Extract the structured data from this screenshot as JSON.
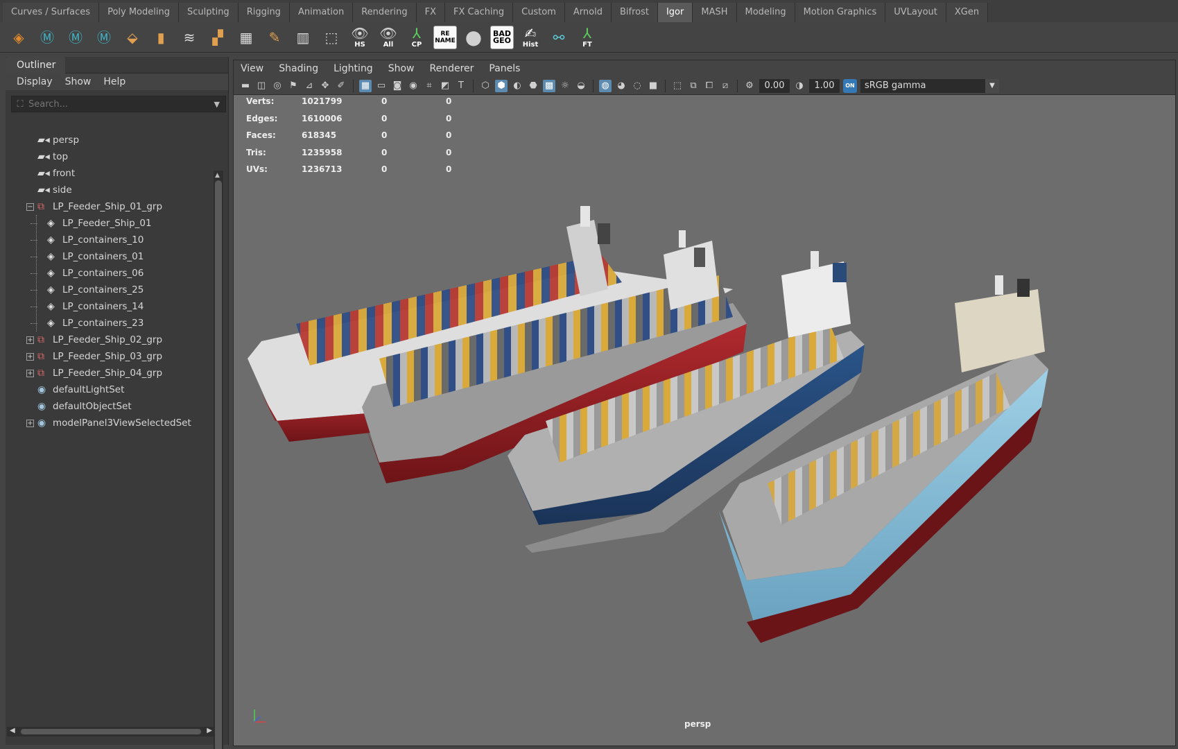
{
  "shelf_tabs": [
    "Curves / Surfaces",
    "Poly Modeling",
    "Sculpting",
    "Rigging",
    "Animation",
    "Rendering",
    "FX",
    "FX Caching",
    "Custom",
    "Arnold",
    "Bifrost",
    "Igor",
    "MASH",
    "Modeling",
    "Motion Graphics",
    "UVLayout",
    "XGen"
  ],
  "active_shelf_tab": "Igor",
  "shelf_tools": {
    "hs": "HS",
    "all": "All",
    "cp": "CP",
    "rename_line1": "RE",
    "rename_line2": "NAME",
    "badgeo_line1": "BAD",
    "badgeo_line2": "GEO",
    "hist": "Hist",
    "ft": "FT"
  },
  "outliner": {
    "title": "Outliner",
    "menu": [
      "Display",
      "Show",
      "Help"
    ],
    "search_placeholder": "Search...",
    "items": [
      {
        "label": "persp",
        "icon": "camera-icon",
        "level": 0,
        "expander": ""
      },
      {
        "label": "top",
        "icon": "camera-icon",
        "level": 0,
        "expander": ""
      },
      {
        "label": "front",
        "icon": "camera-icon",
        "level": 0,
        "expander": ""
      },
      {
        "label": "side",
        "icon": "camera-icon",
        "level": 0,
        "expander": ""
      },
      {
        "label": "LP_Feeder_Ship_01_grp",
        "icon": "group-icon",
        "level": 0,
        "expander": "−"
      },
      {
        "label": "LP_Feeder_Ship_01",
        "icon": "mesh-icon",
        "level": 1,
        "expander": ""
      },
      {
        "label": "LP_containers_10",
        "icon": "mesh-icon",
        "level": 1,
        "expander": ""
      },
      {
        "label": "LP_containers_01",
        "icon": "mesh-icon",
        "level": 1,
        "expander": ""
      },
      {
        "label": "LP_containers_06",
        "icon": "mesh-icon",
        "level": 1,
        "expander": ""
      },
      {
        "label": "LP_containers_25",
        "icon": "mesh-icon",
        "level": 1,
        "expander": ""
      },
      {
        "label": "LP_containers_14",
        "icon": "mesh-icon",
        "level": 1,
        "expander": ""
      },
      {
        "label": "LP_containers_23",
        "icon": "mesh-icon",
        "level": 1,
        "expander": ""
      },
      {
        "label": "LP_Feeder_Ship_02_grp",
        "icon": "group-icon",
        "level": 0,
        "expander": "+"
      },
      {
        "label": "LP_Feeder_Ship_03_grp",
        "icon": "group-icon",
        "level": 0,
        "expander": "+"
      },
      {
        "label": "LP_Feeder_Ship_04_grp",
        "icon": "group-icon",
        "level": 0,
        "expander": "+"
      },
      {
        "label": "defaultLightSet",
        "icon": "set-icon",
        "level": 0,
        "expander": ""
      },
      {
        "label": "defaultObjectSet",
        "icon": "set-icon",
        "level": 0,
        "expander": ""
      },
      {
        "label": "modelPanel3ViewSelectedSet",
        "icon": "set-icon",
        "level": 0,
        "expander": "+"
      }
    ]
  },
  "viewport": {
    "menu": [
      "View",
      "Shading",
      "Lighting",
      "Show",
      "Renderer",
      "Panels"
    ],
    "exposure": "0.00",
    "gamma": "1.00",
    "color_space": "sRGB gamma",
    "color_toggle": "ON",
    "camera": "persp",
    "hud": [
      {
        "key": "Verts:",
        "value": "1021799",
        "c2": "0",
        "c3": "0"
      },
      {
        "key": "Edges:",
        "value": "1610006",
        "c2": "0",
        "c3": "0"
      },
      {
        "key": "Faces:",
        "value": "618345",
        "c2": "0",
        "c3": "0"
      },
      {
        "key": "Tris:",
        "value": "1235958",
        "c2": "0",
        "c3": "0"
      },
      {
        "key": "UVs:",
        "value": "1236713",
        "c2": "0",
        "c3": "0"
      }
    ]
  },
  "colors": {
    "accent": "#5d8bb0",
    "ship_red_hull": "#8b1e22",
    "ship_blue_hull": "#1f3f6b",
    "ship_lightblue_hull": "#7fb3cf",
    "ship_bottom_dark": "#5a0f12"
  }
}
